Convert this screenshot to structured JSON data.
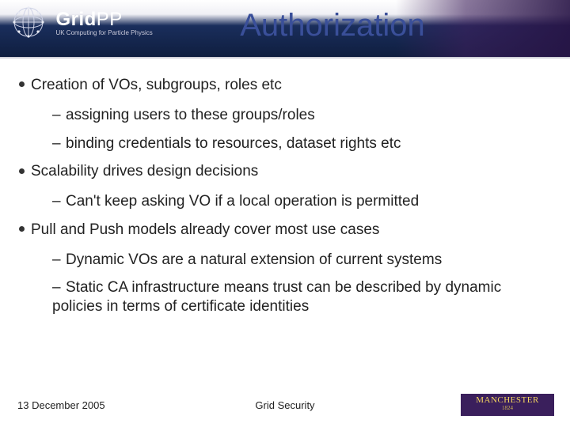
{
  "logo": {
    "main_a": "Grid",
    "main_b": "PP",
    "sub": "UK Computing for Particle Physics"
  },
  "title": "Authorization",
  "bullets": {
    "b1_0": "Creation of VOs, subgroups, roles etc",
    "b2_0": "assigning users to these groups/roles",
    "b2_1": "binding credentials to resources, dataset rights etc",
    "b1_1": "Scalability drives design decisions",
    "b2_2": "Can't keep asking VO if a local operation is permitted",
    "b1_2": "Pull and Push models already cover most use cases",
    "b2_3": "Dynamic VOs are a natural extension of current systems",
    "b2_4": "Static CA infrastructure means trust can be described by dynamic policies in terms of certificate identities"
  },
  "footer": {
    "date": "13 December 2005",
    "center": "Grid Security",
    "uni_line1": "MANCHESTER",
    "uni_line2": "1824"
  }
}
